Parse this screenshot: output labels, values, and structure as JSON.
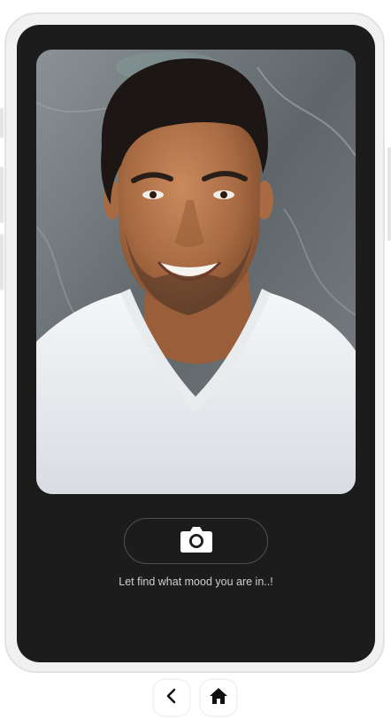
{
  "screen": {
    "photo": {
      "subject": "portrait-of-smiling-man"
    },
    "camera_button": {
      "icon": "camera-icon"
    },
    "caption": "Let find what mood you are in..!"
  },
  "bottom_nav": {
    "back": {
      "icon": "chevron-left-icon"
    },
    "home": {
      "icon": "home-icon"
    }
  },
  "colors": {
    "screen_bg": "#1c1c1c",
    "frame_bg": "#f1f1f1",
    "caption_text": "#cfcfcf",
    "icon_fill": "#ffffff"
  }
}
